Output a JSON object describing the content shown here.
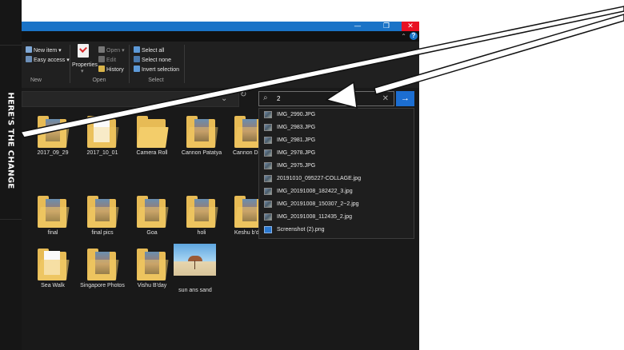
{
  "side_banner": {
    "text": "HERE'S THE CHANGE"
  },
  "window": {
    "titlebar": {
      "minimize": "—",
      "maximize": "❐",
      "close": "✕"
    },
    "help": "?",
    "collapse": "⌃"
  },
  "ribbon": {
    "new_group": {
      "label": "New",
      "new_item": "New item ▾",
      "easy_access": "Easy access ▾"
    },
    "open_group": {
      "label": "Open",
      "properties": "Properties",
      "properties_caret": "▾",
      "open": "Open ▾",
      "edit": "Edit",
      "history": "History"
    },
    "select_group": {
      "label": "Select",
      "select_all": "Select all",
      "select_none": "Select none",
      "invert_selection": "Invert selection"
    }
  },
  "address": {
    "dropdown_icon": "⌄",
    "refresh_icon": "↻"
  },
  "search": {
    "value": "2",
    "clear": "✕",
    "go": "→"
  },
  "search_suggestions": [
    "IMG_2990.JPG",
    "IMG_2983.JPG",
    "IMG_2981.JPG",
    "IMG_2978.JPG",
    "IMG_2975.JPG",
    "20191010_095227-COLLAGE.jpg",
    "IMG_20191008_182422_3.jpg",
    "IMG_20191008_150307_2~2.jpg",
    "IMG_20191008_112435_2.jpg",
    "Screenshot (2).png"
  ],
  "folders": [
    "2017_09_29",
    "2017_10_01",
    "Camera Roll",
    "Cannon Patatya",
    "Cannon Diwa",
    "final",
    "final pics",
    "Goa",
    "holi",
    "Keshu b'day",
    "Sea Walk",
    "Singapore Photos",
    "Vishu B'day",
    "sun ans sand"
  ],
  "colors": {
    "accent": "#1c6ed1",
    "titlebar": "#1a73c7",
    "close": "#e81123",
    "folder": "#e7bb55"
  }
}
